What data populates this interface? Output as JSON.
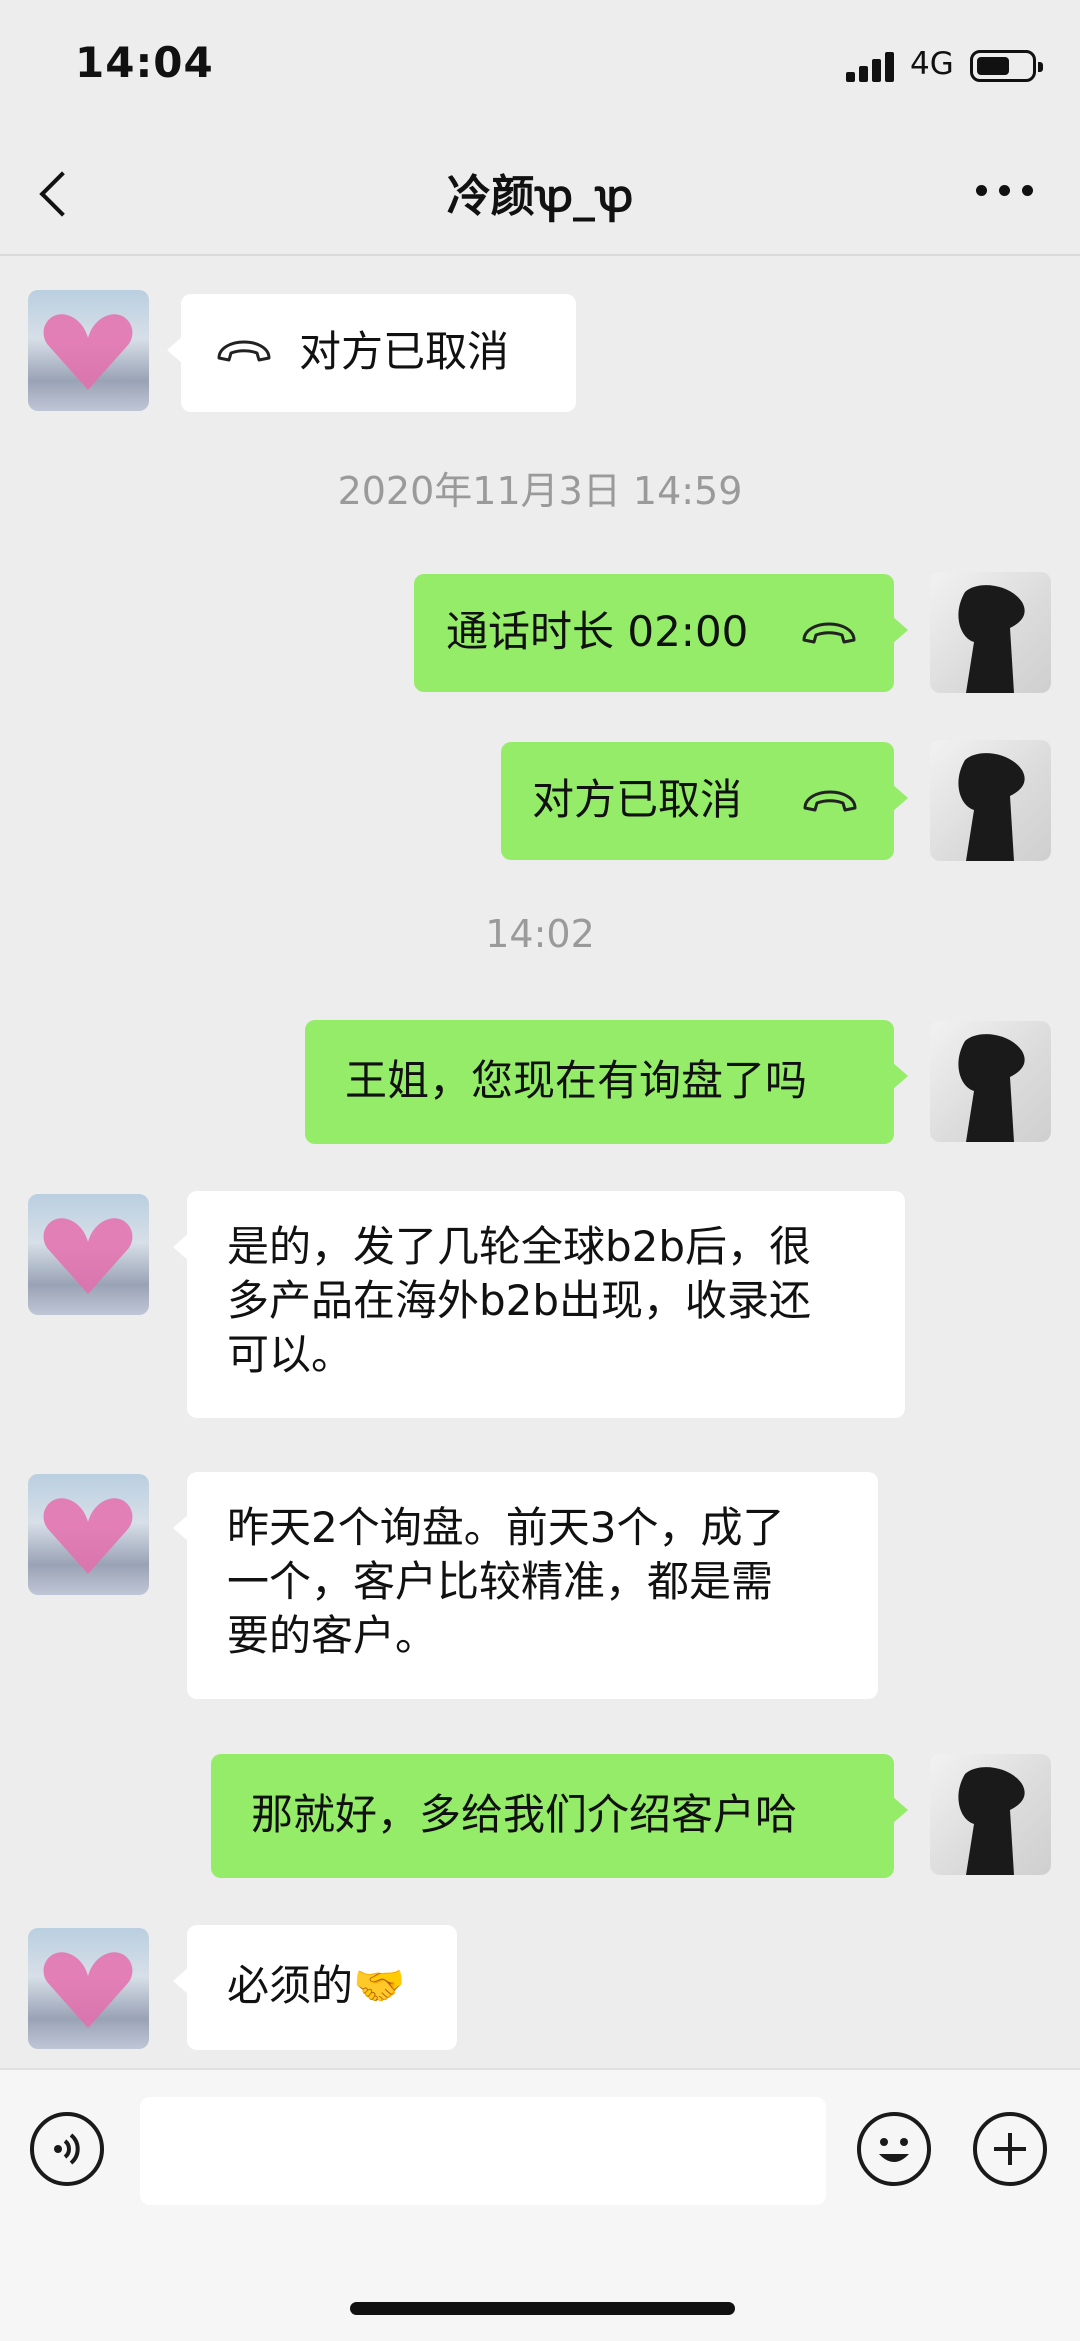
{
  "status_bar": {
    "time": "14:04",
    "network": "4G",
    "signal_icon": "signal-bars-icon",
    "battery_icon": "battery-icon"
  },
  "header": {
    "title": "冷颜ꝕ_ꝕ",
    "back_icon": "chevron-left-icon",
    "more_icon": "more-dots-icon"
  },
  "messages": [
    {
      "side": "them",
      "type": "call",
      "text": "对方已取消",
      "icon": "phone-hangup-icon"
    },
    {
      "type": "timestamp",
      "text": "2020年11月3日 14:59"
    },
    {
      "side": "me",
      "type": "call",
      "text": "通话时长  02:00",
      "icon": "phone-hangup-icon"
    },
    {
      "side": "me",
      "type": "call",
      "text": "对方已取消",
      "icon": "phone-hangup-icon"
    },
    {
      "type": "timestamp",
      "text": "14:02"
    },
    {
      "side": "me",
      "type": "text",
      "text": "王姐，您现在有询盘了吗"
    },
    {
      "side": "them",
      "type": "text",
      "text": "是的，发了几轮全球b2b后，很\n多产品在海外b2b出现，收录还\n可以。"
    },
    {
      "side": "them",
      "type": "text",
      "text": "昨天2个询盘。前天3个，成了\n一个，客户比较精准，都是需\n要的客户。"
    },
    {
      "side": "me",
      "type": "text",
      "text": "那就好，多给我们介绍客户哈"
    },
    {
      "side": "them",
      "type": "text",
      "text": "必须的",
      "emoji": "🤝"
    }
  ],
  "input_bar": {
    "voice_icon": "voice-icon",
    "emoji_icon": "emoji-icon",
    "add_icon": "plus-icon",
    "placeholder": ""
  },
  "colors": {
    "background": "#EDEDED",
    "my_bubble": "#95EC69",
    "their_bubble": "#FFFFFF",
    "timestamp": "#9A9A9A"
  }
}
